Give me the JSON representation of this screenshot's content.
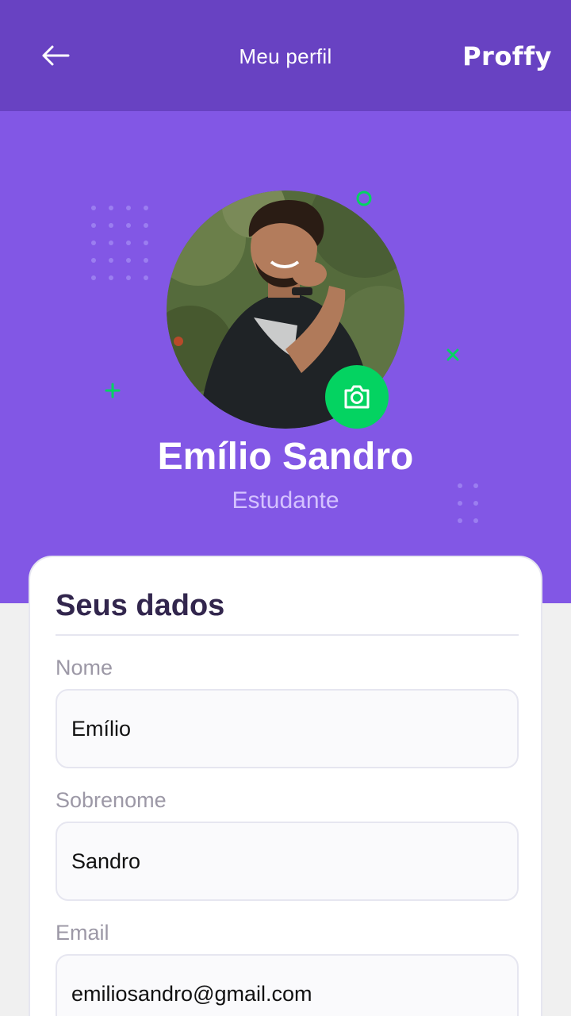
{
  "header": {
    "title": "Meu perfil",
    "back_icon": "arrow-left-icon",
    "brand": "Proffy"
  },
  "profile": {
    "name": "Emílio Sandro",
    "role": "Estudante",
    "avatar": "profile-photo",
    "camera_icon": "camera-icon"
  },
  "form": {
    "title": "Seus dados",
    "fields": [
      {
        "label": "Nome",
        "value": "Emílio"
      },
      {
        "label": "Sobrenome",
        "value": "Sandro"
      },
      {
        "label": "Email",
        "value": "emiliosandro@gmail.com"
      }
    ]
  },
  "colors": {
    "header_bg": "#6842c2",
    "hero_bg": "#8257e5",
    "accent_green": "#04d361",
    "page_bg": "#f0f0f0",
    "title_text": "#32264d",
    "label_text": "#9c98a6"
  }
}
